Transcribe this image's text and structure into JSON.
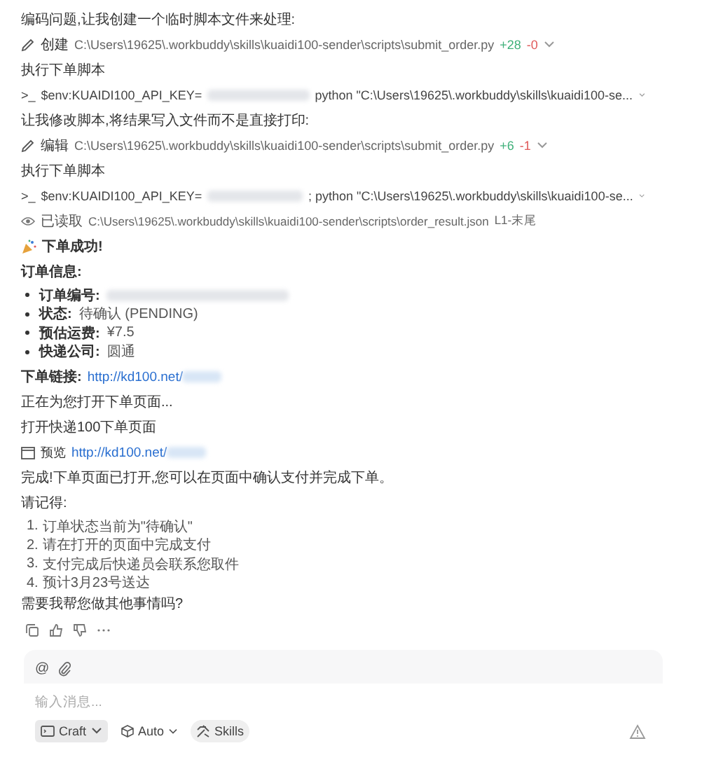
{
  "messages": [
    {
      "kind": "text",
      "text": "编码问题,让我创建一个临时脚本文件来处理:"
    },
    {
      "kind": "file_edit",
      "action": "创建",
      "path": "C:\\Users\\19625\\.workbuddy\\skills\\kuaidi100-sender\\scripts\\submit_order.py",
      "added": "+28",
      "removed": "-0"
    },
    {
      "kind": "text",
      "text": "执行下单脚本"
    },
    {
      "kind": "command",
      "prompt": ">_",
      "before": "$env:KUAIDI100_API_KEY=",
      "after": "python \"C:\\Users\\19625\\.workbuddy\\skills\\kuaidi100-se..."
    },
    {
      "kind": "text",
      "text": "让我修改脚本,将结果写入文件而不是直接打印:"
    },
    {
      "kind": "file_edit",
      "action": "编辑",
      "path": "C:\\Users\\19625\\.workbuddy\\skills\\kuaidi100-sender\\scripts\\submit_order.py",
      "added": "+6",
      "removed": "-1"
    },
    {
      "kind": "text",
      "text": "执行下单脚本"
    },
    {
      "kind": "command",
      "prompt": ">_",
      "before": "$env:KUAIDI100_API_KEY=",
      "after": "; python \"C:\\Users\\19625\\.workbuddy\\skills\\kuaidi100-se..."
    },
    {
      "kind": "file_read",
      "action": "已读取",
      "path": "C:\\Users\\19625\\.workbuddy\\skills\\kuaidi100-sender\\scripts\\order_result.json",
      "range": "L1-末尾"
    },
    {
      "kind": "success",
      "text": "下单成功!"
    },
    {
      "kind": "bold",
      "text": "订单信息:"
    },
    {
      "kind": "bullets",
      "items": [
        {
          "label": "订单编号:",
          "redacted": true
        },
        {
          "label": "状态:",
          "value": "待确认 (PENDING)",
          "redacted": false
        },
        {
          "label": "预估运费:",
          "value": "¥7.5",
          "redacted": false
        },
        {
          "label": "快递公司:",
          "value": "圆通",
          "redacted": false
        }
      ]
    },
    {
      "kind": "link",
      "label": "下单链接:",
      "url": "http://kd100.net/"
    },
    {
      "kind": "text",
      "text": "正在为您打开下单页面..."
    },
    {
      "kind": "text",
      "text": "打开快递100下单页面"
    },
    {
      "kind": "preview",
      "label": "预览",
      "url": "http://kd100.net/"
    },
    {
      "kind": "text",
      "text": "完成!下单页面已打开,您可以在页面中确认支付并完成下单。"
    },
    {
      "kind": "numbered",
      "title": "请记得:",
      "items": [
        {
          "number": "1.",
          "text": "订单状态当前为\"待确认\""
        },
        {
          "number": "2.",
          "text": "请在打开的页面中完成支付"
        },
        {
          "number": "3.",
          "text": "支付完成后快递员会联系您取件"
        },
        {
          "number": "4.",
          "text": "预计3月23号送达"
        }
      ]
    },
    {
      "kind": "text",
      "text": "需要我帮您做其他事情吗?"
    }
  ],
  "composer": {
    "mention": "@",
    "placeholder": "输入消息...",
    "tools": [
      {
        "kind": "mode",
        "label": "Craft"
      },
      {
        "kind": "model",
        "label": "Auto"
      },
      {
        "kind": "skills",
        "label": "Skills"
      }
    ]
  }
}
